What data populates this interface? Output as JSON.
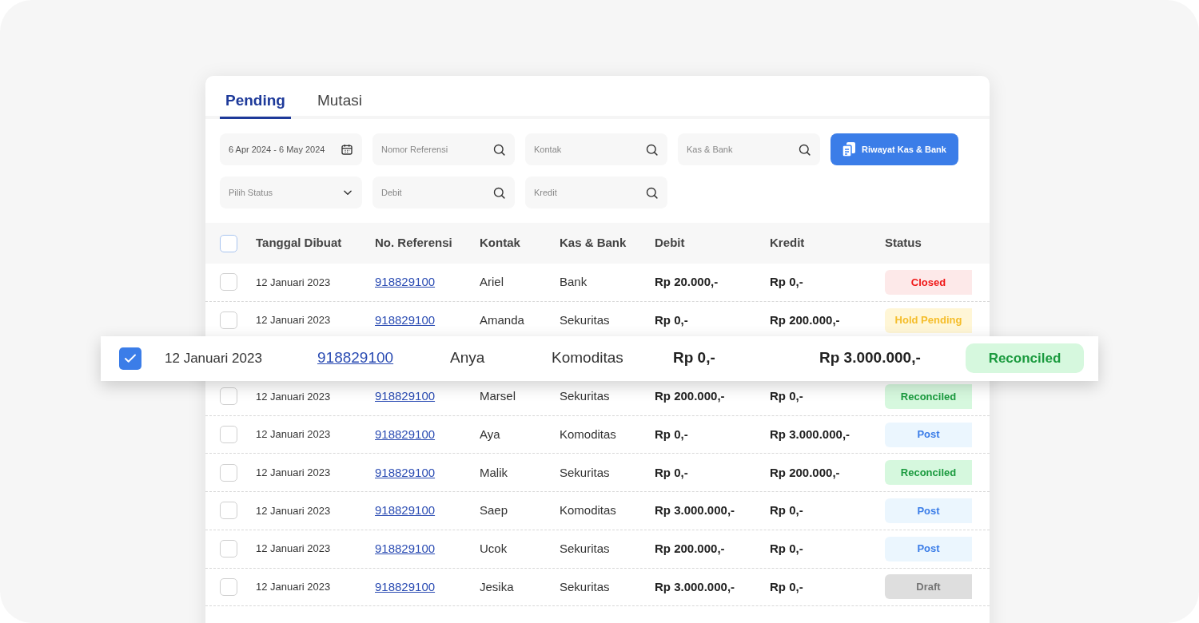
{
  "tabs": [
    {
      "label": "Pending",
      "selected": true
    },
    {
      "label": "Mutasi",
      "selected": false
    }
  ],
  "filters": [
    {
      "kind": "date",
      "value": "6 Apr 2024 - 6 May 2024"
    },
    {
      "kind": "search",
      "placeholder": "Nomor Referensi"
    },
    {
      "kind": "search",
      "placeholder": "Kontak"
    },
    {
      "kind": "search",
      "placeholder": "Kas & Bank"
    },
    {
      "kind": "select",
      "placeholder": "Pilih Status"
    },
    {
      "kind": "search",
      "placeholder": "Debit"
    },
    {
      "kind": "search",
      "placeholder": "Kredit"
    }
  ],
  "history_button": {
    "label": "Riwayat Kas & Bank"
  },
  "table": {
    "header_checked": false,
    "columns": [
      "Tanggal Dibuat",
      "No. Referensi",
      "Kontak",
      "Kas & Bank",
      "Debit",
      "Kredit",
      "Status"
    ],
    "rows": [
      {
        "checked": false,
        "lifted": false,
        "date": "12 Januari 2023",
        "reference": "918829100",
        "contact": "Ariel",
        "account": "Bank",
        "debit": "Rp 20.000,-",
        "credit": "Rp 0,-",
        "status": {
          "label": "Closed",
          "kind": "closed"
        }
      },
      {
        "checked": false,
        "lifted": false,
        "date": "12 Januari 2023",
        "reference": "918829100",
        "contact": "Amanda",
        "account": "Sekuritas",
        "debit": "Rp 0,-",
        "credit": "Rp 200.000,-",
        "status": {
          "label": "Hold Pending",
          "kind": "hold"
        }
      },
      {
        "checked": true,
        "lifted": true,
        "date": "12 Januari 2023",
        "reference": "918829100",
        "contact": "Anya",
        "account": "Komoditas",
        "debit": "Rp 0,-",
        "credit": "Rp 3.000.000,-",
        "status": {
          "label": "Reconciled",
          "kind": "reconciled"
        }
      },
      {
        "checked": false,
        "lifted": false,
        "date": "12 Januari 2023",
        "reference": "918829100",
        "contact": "Marsel",
        "account": "Sekuritas",
        "debit": "Rp 200.000,-",
        "credit": "Rp 0,-",
        "status": {
          "label": "Reconciled",
          "kind": "reconciled"
        }
      },
      {
        "checked": false,
        "lifted": false,
        "date": "12 Januari 2023",
        "reference": "918829100",
        "contact": "Aya",
        "account": "Komoditas",
        "debit": "Rp 0,-",
        "credit": "Rp 3.000.000,-",
        "status": {
          "label": "Post",
          "kind": "post"
        }
      },
      {
        "checked": false,
        "lifted": false,
        "date": "12 Januari 2023",
        "reference": "918829100",
        "contact": "Malik",
        "account": "Sekuritas",
        "debit": "Rp 0,-",
        "credit": "Rp 200.000,-",
        "status": {
          "label": "Reconciled",
          "kind": "reconciled"
        }
      },
      {
        "checked": false,
        "lifted": false,
        "date": "12 Januari 2023",
        "reference": "918829100",
        "contact": "Saep",
        "account": "Komoditas",
        "debit": "Rp 3.000.000,-",
        "credit": "Rp 0,-",
        "status": {
          "label": "Post",
          "kind": "post"
        }
      },
      {
        "checked": false,
        "lifted": false,
        "date": "12 Januari 2023",
        "reference": "918829100",
        "contact": "Ucok",
        "account": "Sekuritas",
        "debit": "Rp 200.000,-",
        "credit": "Rp 0,-",
        "status": {
          "label": "Post",
          "kind": "post"
        }
      },
      {
        "checked": false,
        "lifted": false,
        "date": "12 Januari 2023",
        "reference": "918829100",
        "contact": "Jesika",
        "account": "Sekuritas",
        "debit": "Rp 3.000.000,-",
        "credit": "Rp 0,-",
        "status": {
          "label": "Draft",
          "kind": "draft"
        }
      }
    ]
  }
}
